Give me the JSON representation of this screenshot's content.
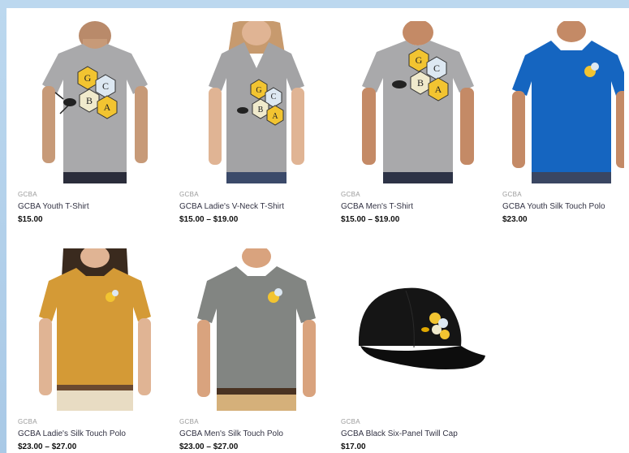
{
  "colors": {
    "page_bg": "#b7d4ee",
    "panel_bg": "#ffffff",
    "shirt_gray": "#a8a8aa",
    "polo_blue": "#1565c0",
    "polo_gold": "#d49a36",
    "polo_gray": "#828582",
    "cap_black": "#151515"
  },
  "products": [
    {
      "brand": "GCBA",
      "title": "GCBA Youth T-Shirt",
      "price": "$15.00"
    },
    {
      "brand": "GCBA",
      "title": "GCBA Ladie's V-Neck T-Shirt",
      "price": "$15.00 – $19.00"
    },
    {
      "brand": "GCBA",
      "title": "GCBA Men's T-Shirt",
      "price": "$15.00 – $19.00"
    },
    {
      "brand": "GCBA",
      "title": "GCBA Youth Silk Touch Polo",
      "price": "$23.00"
    },
    {
      "brand": "GCBA",
      "title": "GCBA Ladie's Silk Touch Polo",
      "price": "$23.00 – $27.00"
    },
    {
      "brand": "GCBA",
      "title": "GCBA Men's Silk Touch Polo",
      "price": "$23.00 – $27.00"
    },
    {
      "brand": "GCBA",
      "title": "GCBA Black Six-Panel Twill Cap",
      "price": "$17.00"
    }
  ]
}
